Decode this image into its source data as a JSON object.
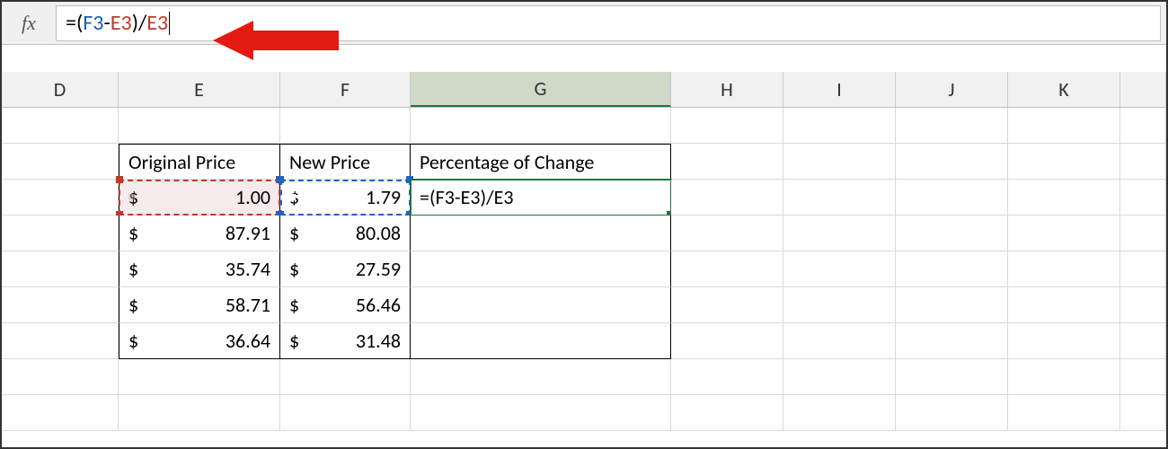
{
  "formula_bar": {
    "fx_label": "fx",
    "formula_prefix": "=",
    "lp": "(",
    "refF3": "F3",
    "minus": "-",
    "refE3": "E3",
    "rp": ")",
    "div": "/",
    "refE3b": "E3"
  },
  "columns": {
    "D": "D",
    "E": "E",
    "F": "F",
    "G": "G",
    "H": "H",
    "I": "I",
    "J": "J",
    "K": "K"
  },
  "headers": {
    "E": "Original Price",
    "F": "New Price",
    "G": "Percentage of Change"
  },
  "active_formula_display": "=(F3-E3)/E3",
  "currency_symbol": "$",
  "data_rows": [
    {
      "E": "1.00",
      "F": "1.79"
    },
    {
      "E": "87.91",
      "F": "80.08"
    },
    {
      "E": "35.74",
      "F": "27.59"
    },
    {
      "E": "58.71",
      "F": "56.46"
    },
    {
      "E": "36.64",
      "F": "31.48"
    }
  ],
  "colors": {
    "ref_blue": "#1a5bbd",
    "ref_red": "#c0392b",
    "excel_green": "#217346",
    "arrow_red": "#e31b12"
  }
}
